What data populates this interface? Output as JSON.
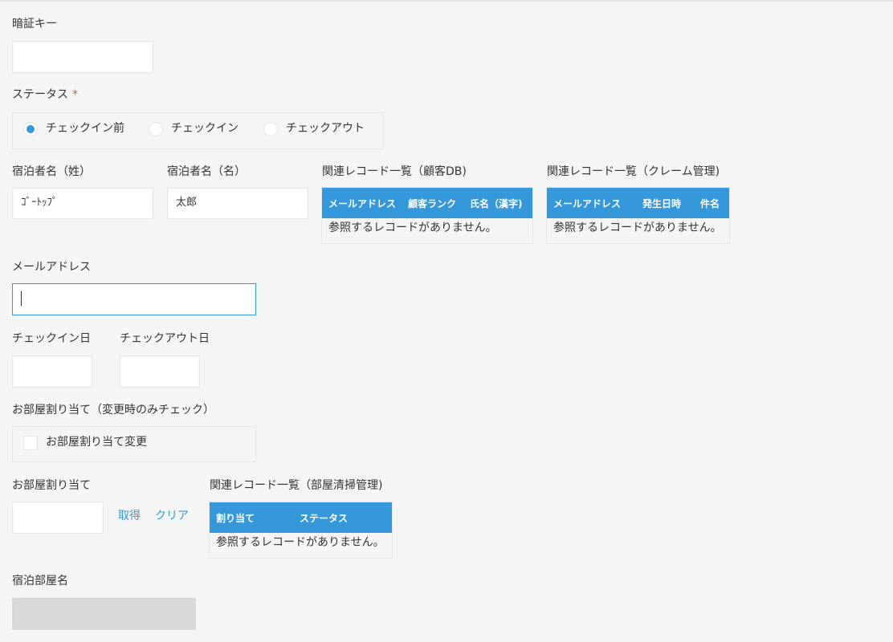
{
  "fields": {
    "auth_key": {
      "label": "暗証キー",
      "value": ""
    },
    "status": {
      "label": "ステータス",
      "required_mark": "*",
      "options": [
        "チェックイン前",
        "チェックイン",
        "チェックアウト"
      ],
      "selected": "チェックイン前"
    },
    "guest_last_name": {
      "label": "宿泊者名（姓）",
      "value": "ｺﾞｰﾄｯﾌﾟ"
    },
    "guest_first_name": {
      "label": "宿泊者名（名）",
      "value": "太郎"
    },
    "email": {
      "label": "メールアドレス",
      "value": ""
    },
    "checkin_date": {
      "label": "チェックイン日",
      "value": ""
    },
    "checkout_date": {
      "label": "チェックアウト日",
      "value": ""
    },
    "room_change": {
      "label": "お部屋割り当て（変更時のみチェック）",
      "checkbox_label": "お部屋割り当て変更",
      "checked": false
    },
    "room_assign": {
      "label": "お部屋割り当て",
      "value": "",
      "fetch_label": "取得",
      "clear_label": "クリア"
    },
    "room_name": {
      "label": "宿泊部屋名",
      "value": ""
    }
  },
  "related_tables": {
    "customers": {
      "label": "関連レコード一覧（顧客DB)",
      "columns": [
        "メールアドレス",
        "顧客ランク",
        "氏名（漢字)"
      ],
      "empty_message": "参照するレコードがありません。"
    },
    "claims": {
      "label": "関連レコード一覧（クレーム管理)",
      "columns": [
        "メールアドレス",
        "発生日時",
        "件名"
      ],
      "empty_message": "参照するレコードがありません。"
    },
    "cleaning": {
      "label": "関連レコード一覧（部屋清掃管理)",
      "columns": [
        "割り当て",
        "ステータス"
      ],
      "empty_message": "参照するレコードがありません。"
    }
  },
  "colors": {
    "accent": "#3498db",
    "required": "#e74c3c",
    "border": "#e3e7e8",
    "background": "#f5f5f5",
    "disabled": "#d8dadb"
  }
}
